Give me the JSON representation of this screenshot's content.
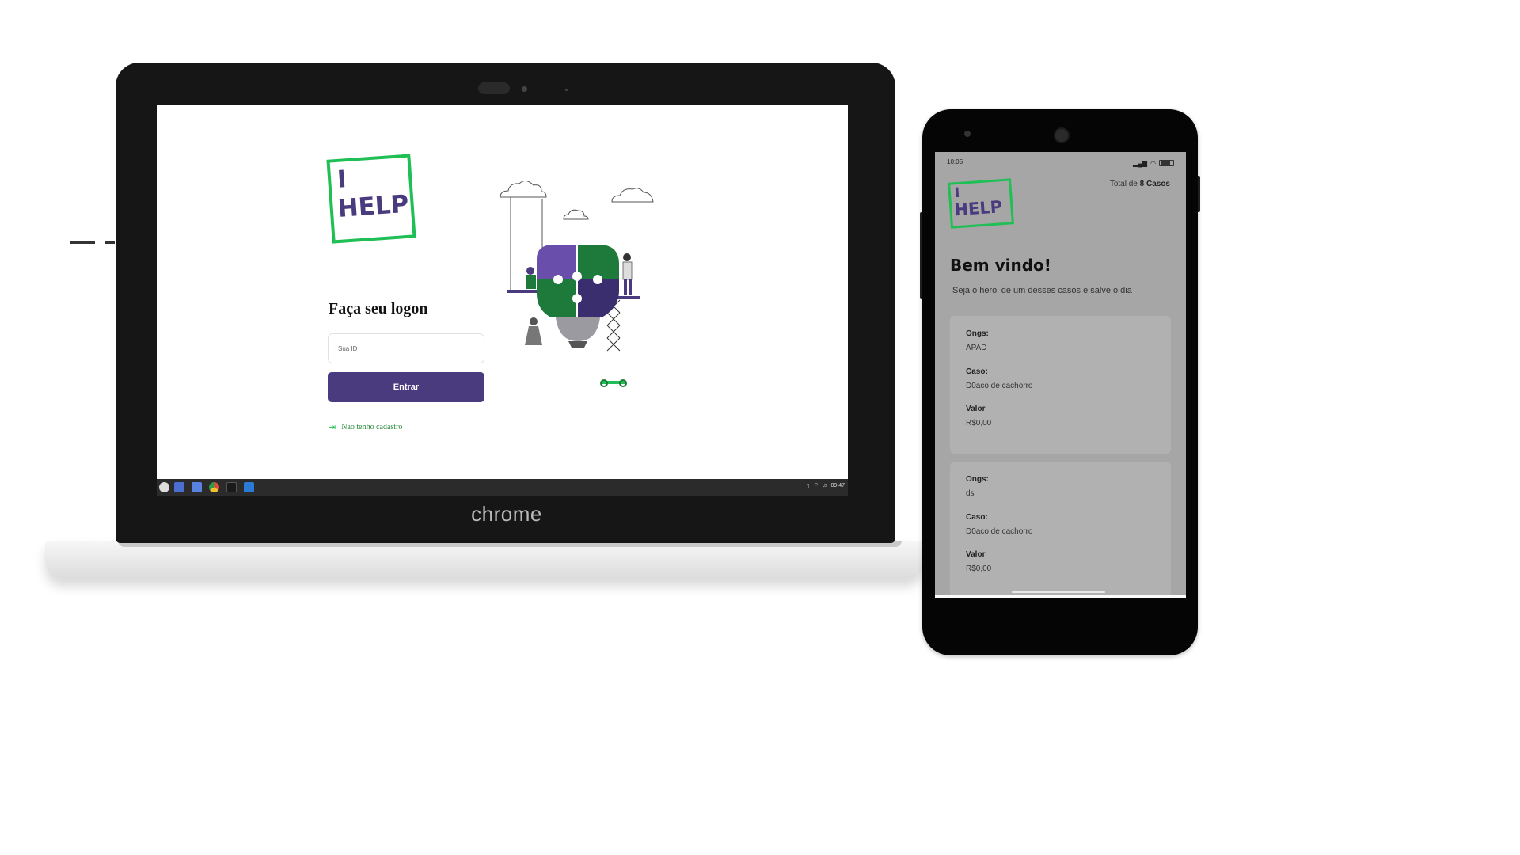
{
  "laptop": {
    "brand": "chrome",
    "login": {
      "logo_line1": "I",
      "logo_line2": "HELP",
      "heading": "Faça seu logon",
      "id_placeholder": "Sua ID",
      "submit_label": "Entrar",
      "register_link": "Nao tenho cadastro"
    },
    "taskbar": {
      "icons": [
        "apps-launcher-icon",
        "files-icon",
        "folder-icon",
        "chrome-icon",
        "terminal-icon",
        "vscode-icon"
      ],
      "clock": "09:47"
    }
  },
  "phone": {
    "status_time": "10:05",
    "logo_line1": "I",
    "logo_line2": "HELP",
    "total_prefix": "Total de",
    "total_value": "8 Casos",
    "welcome": "Bem vindo!",
    "subtitle": "Seja o heroi de um desses casos e salve o dia",
    "cases": [
      {
        "ong_label": "Ongs:",
        "ong": "APAD",
        "caso_label": "Caso:",
        "caso": "D0aco de cachorro",
        "valor_label": "Valor",
        "valor": "R$0,00"
      },
      {
        "ong_label": "Ongs:",
        "ong": "ds",
        "caso_label": "Caso:",
        "caso": "D0aco de cachorro",
        "valor_label": "Valor",
        "valor": "R$0,00"
      }
    ]
  },
  "colors": {
    "brand_purple": "#4a3a7e",
    "brand_green": "#1fbf55",
    "link_green": "#2a8a3a"
  }
}
